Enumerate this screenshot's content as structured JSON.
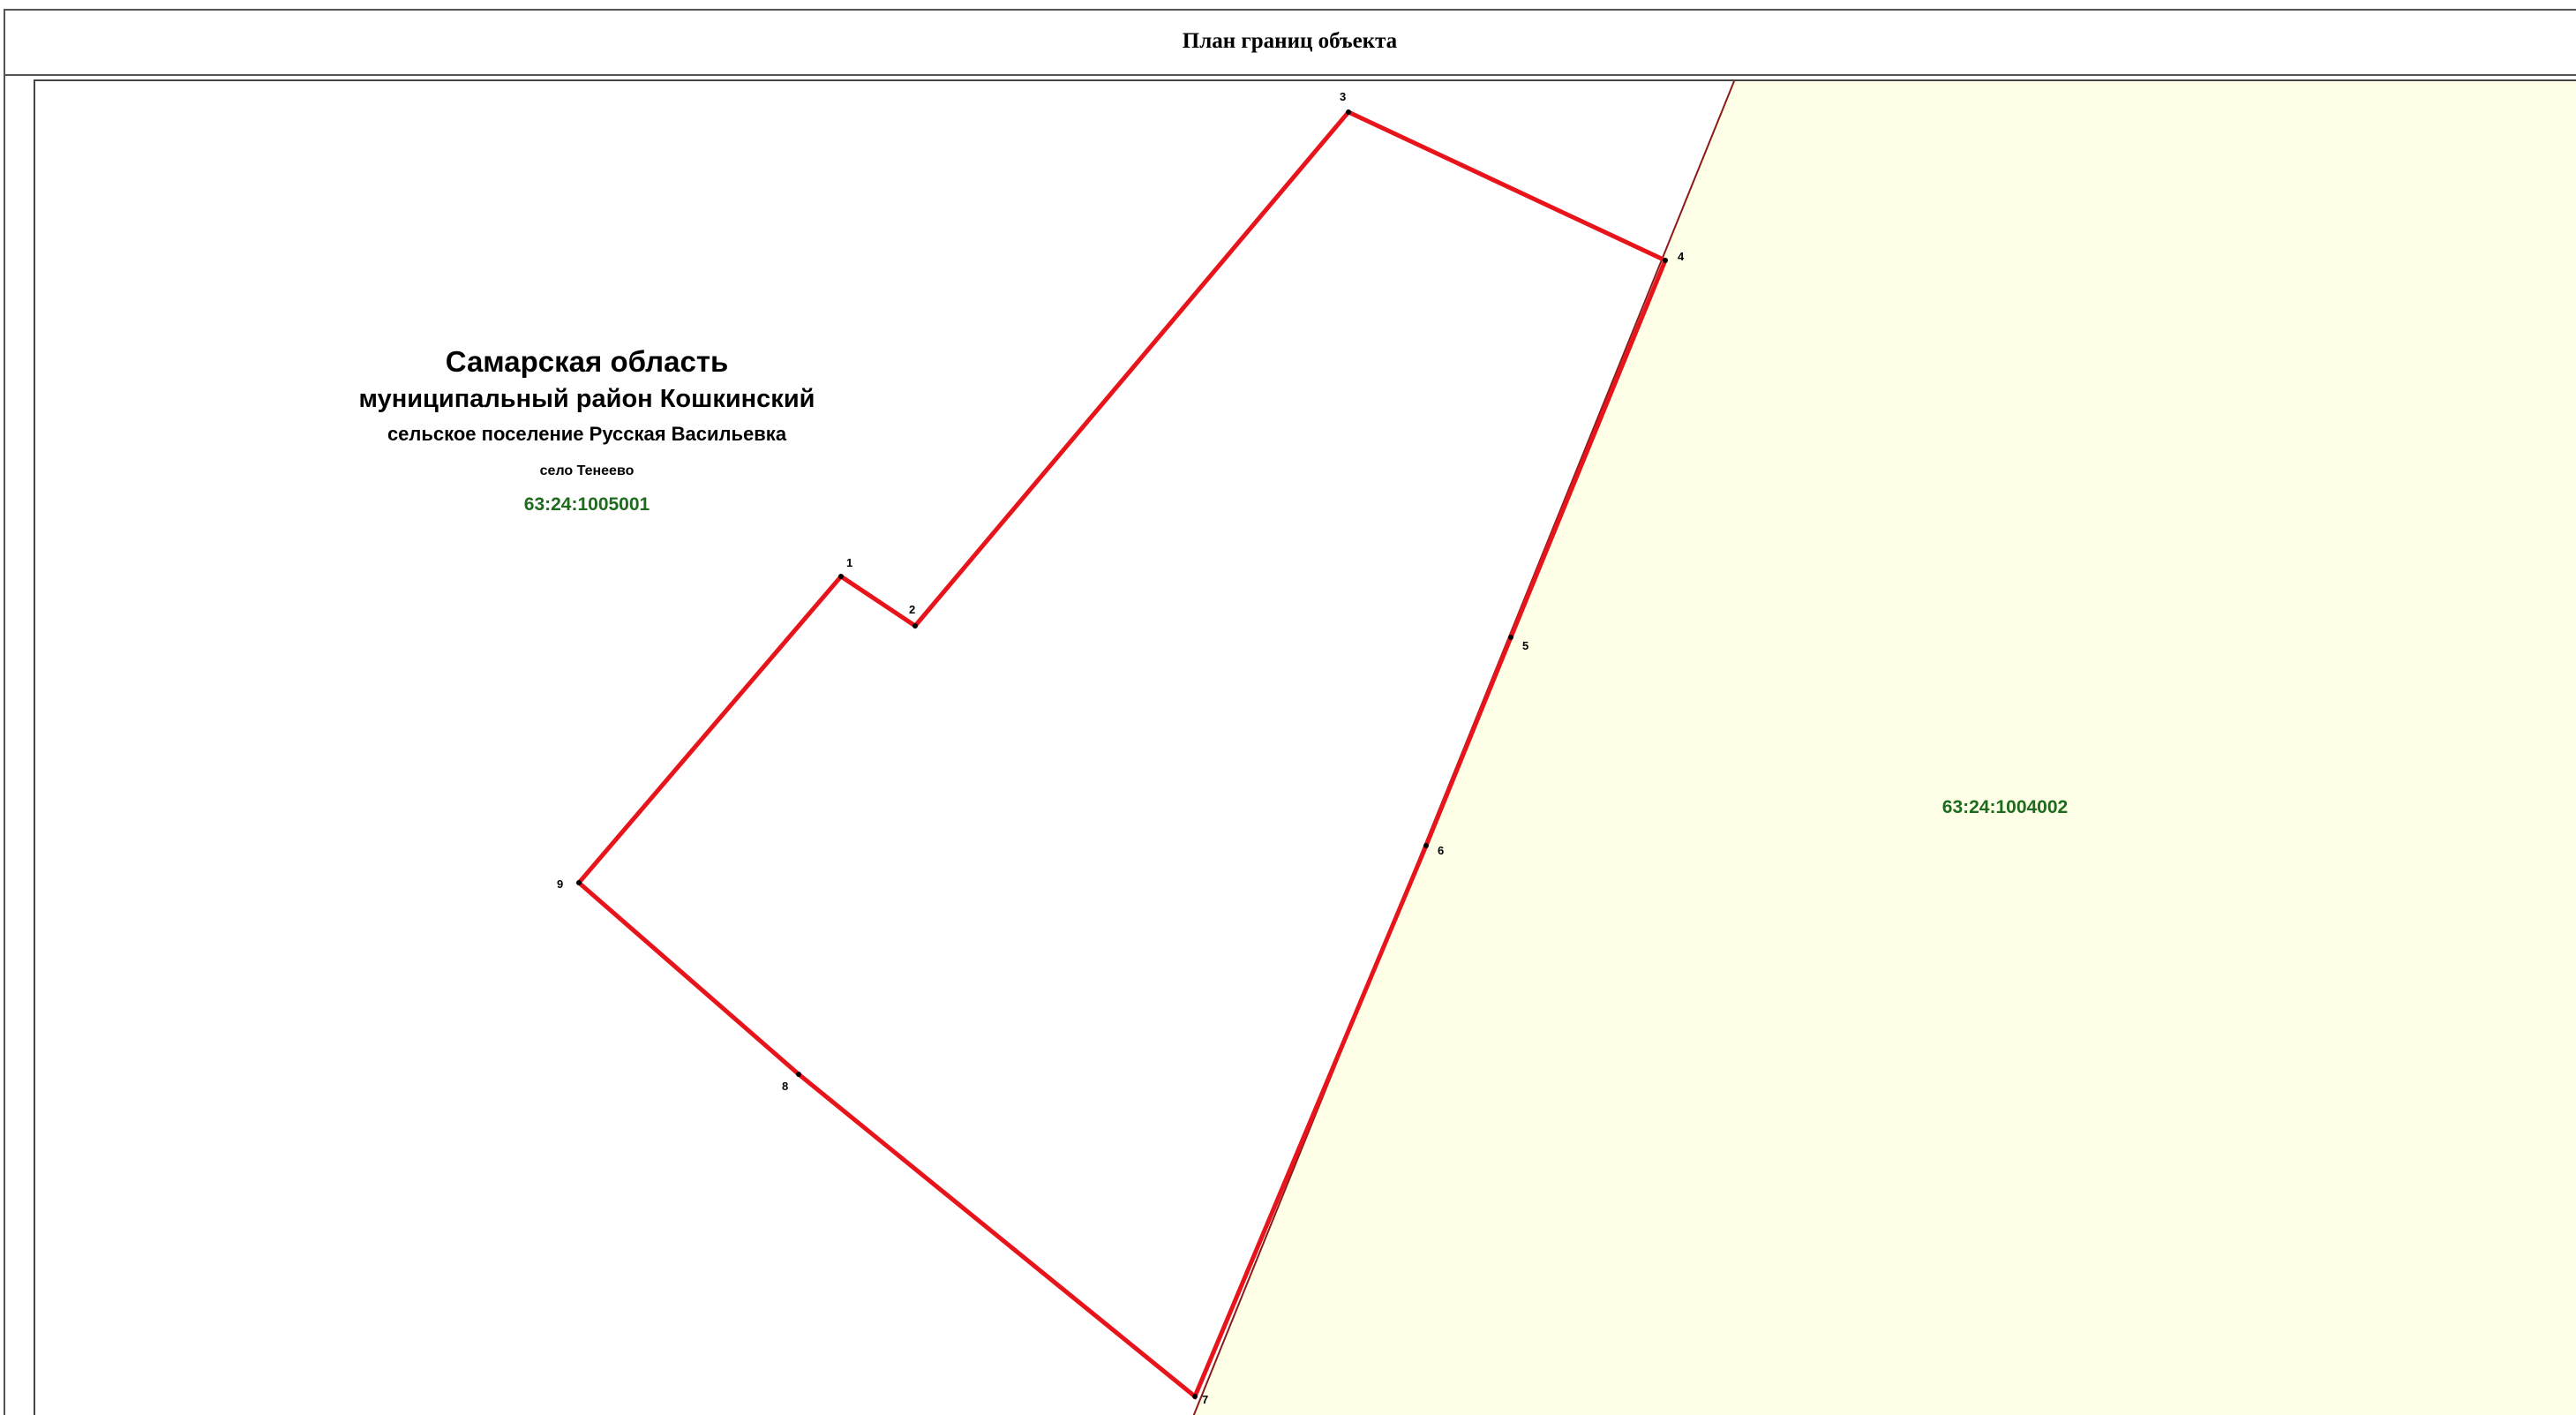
{
  "header": {
    "title": "План границ объекта"
  },
  "map": {
    "colors": {
      "parcel_boundary": "#e8141b",
      "neighbor_fill": "#ffffe8",
      "neighbor_boundary": "#8b1a1a",
      "cadastre_label": "#1d6b1d"
    },
    "admin_labels": {
      "region": "Самарская область",
      "district": "муниципальный район Кошкинский",
      "settlement": "сельское поселение Русская Васильевка",
      "village": "село Тенеево",
      "quarter": "63:24:1005001"
    },
    "neighbor_quarter_label": "63:24:1004002",
    "points": [
      {
        "label": "1"
      },
      {
        "label": "2"
      },
      {
        "label": "3"
      },
      {
        "label": "4"
      },
      {
        "label": "5"
      },
      {
        "label": "6"
      },
      {
        "label": "7"
      },
      {
        "label": "8"
      },
      {
        "label": "9"
      }
    ]
  }
}
